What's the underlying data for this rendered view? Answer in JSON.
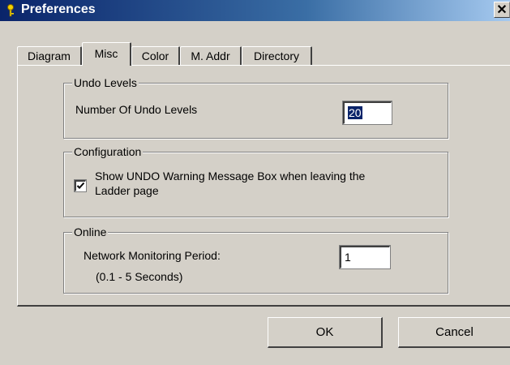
{
  "window": {
    "title": "Preferences",
    "close_glyph": "✕"
  },
  "tabs": [
    {
      "label": "Diagram",
      "active": false
    },
    {
      "label": "Misc",
      "active": true
    },
    {
      "label": "Color",
      "active": false
    },
    {
      "label": "M. Addr",
      "active": false
    },
    {
      "label": "Directory",
      "active": false
    }
  ],
  "undo": {
    "group_label": "Undo Levels",
    "field_label": "Number Of Undo Levels",
    "value": "20"
  },
  "configuration": {
    "group_label": "Configuration",
    "checkbox_label_line1": "Show UNDO Warning Message Box when leaving the",
    "checkbox_label_line2": "Ladder page",
    "checked": true
  },
  "online": {
    "group_label": "Online",
    "field_label": "Network Monitoring Period:",
    "range_note": "(0.1 - 5 Seconds)",
    "value": "1"
  },
  "buttons": {
    "ok": "OK",
    "cancel": "Cancel"
  },
  "colors": {
    "title_bar": "#0a246a",
    "dialog_bg": "#d4d0c8",
    "selection": "#0a246a"
  }
}
